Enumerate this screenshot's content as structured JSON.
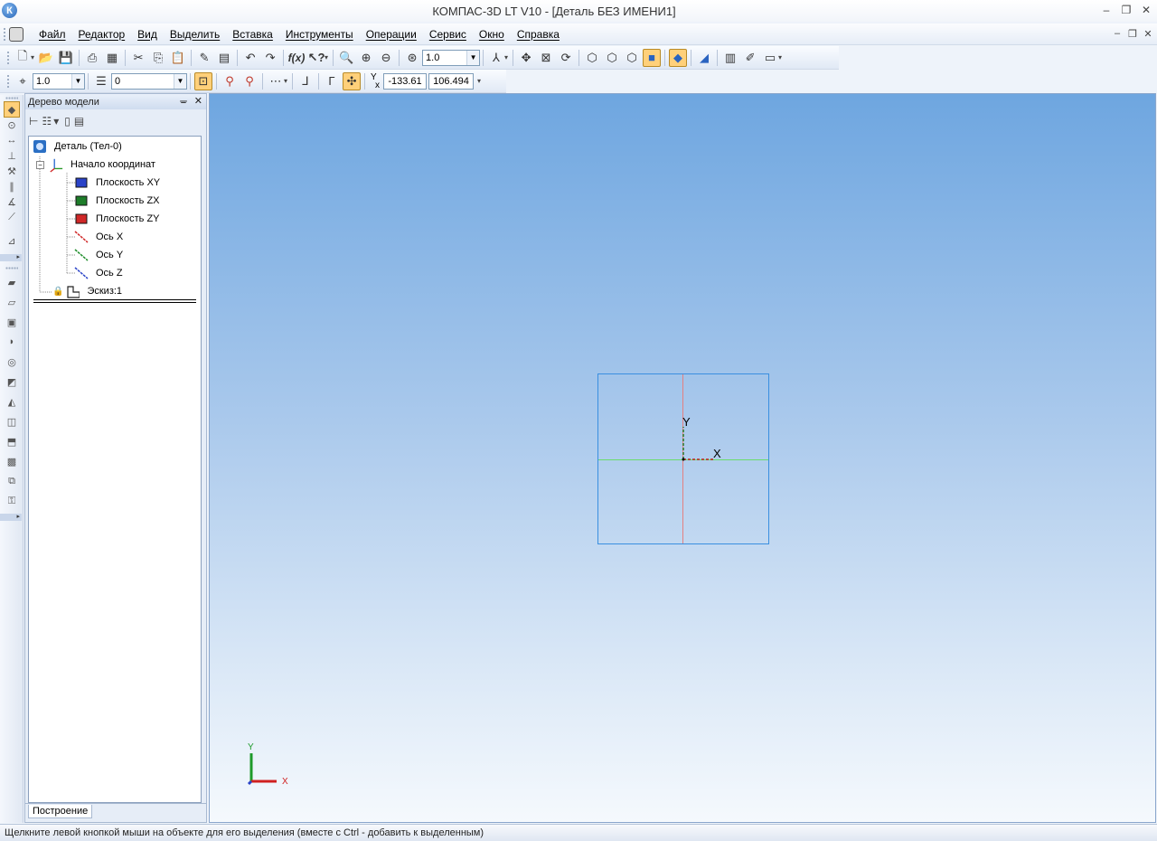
{
  "window": {
    "title": "КОМПАС-3D LT V10 - [Деталь БЕЗ ИМЕНИ1]",
    "logo_letter": "К"
  },
  "menu": {
    "items": [
      "Файл",
      "Редактор",
      "Вид",
      "Выделить",
      "Вставка",
      "Инструменты",
      "Операции",
      "Сервис",
      "Окно",
      "Справка"
    ]
  },
  "toolbar_main": {
    "zoom_value": "1.0"
  },
  "toolbar_props": {
    "step_value": "1.0",
    "layer_value": "0",
    "coord_label_y": "Y",
    "coord_label_x": "x",
    "coord_x": "-133.61",
    "coord_y": "106.494"
  },
  "tree": {
    "header_title": "Дерево модели",
    "root": "Деталь (Тел-0)",
    "origin": "Начало координат",
    "planes": [
      "Плоскость XY",
      "Плоскость ZX",
      "Плоскость ZY"
    ],
    "axes": [
      "Ось X",
      "Ось Y",
      "Ось Z"
    ],
    "sketch": "Эскиз:1",
    "tab": "Построение"
  },
  "viewport": {
    "sketch_y_label": "Y",
    "sketch_x_label": "X",
    "triad_y_label": "Y",
    "triad_x_label": "X"
  },
  "statusbar": {
    "text": "Щелкните левой кнопкой мыши на объекте для его выделения (вместе с Ctrl - добавить к выделенным)"
  },
  "colors": {
    "viewport_top": "#6ea6e0",
    "sketch_border": "#3a8fe0",
    "axis_x_line": "#6bdc6b",
    "axis_y_line": "#e48080",
    "highlight": "#ffd07a"
  }
}
